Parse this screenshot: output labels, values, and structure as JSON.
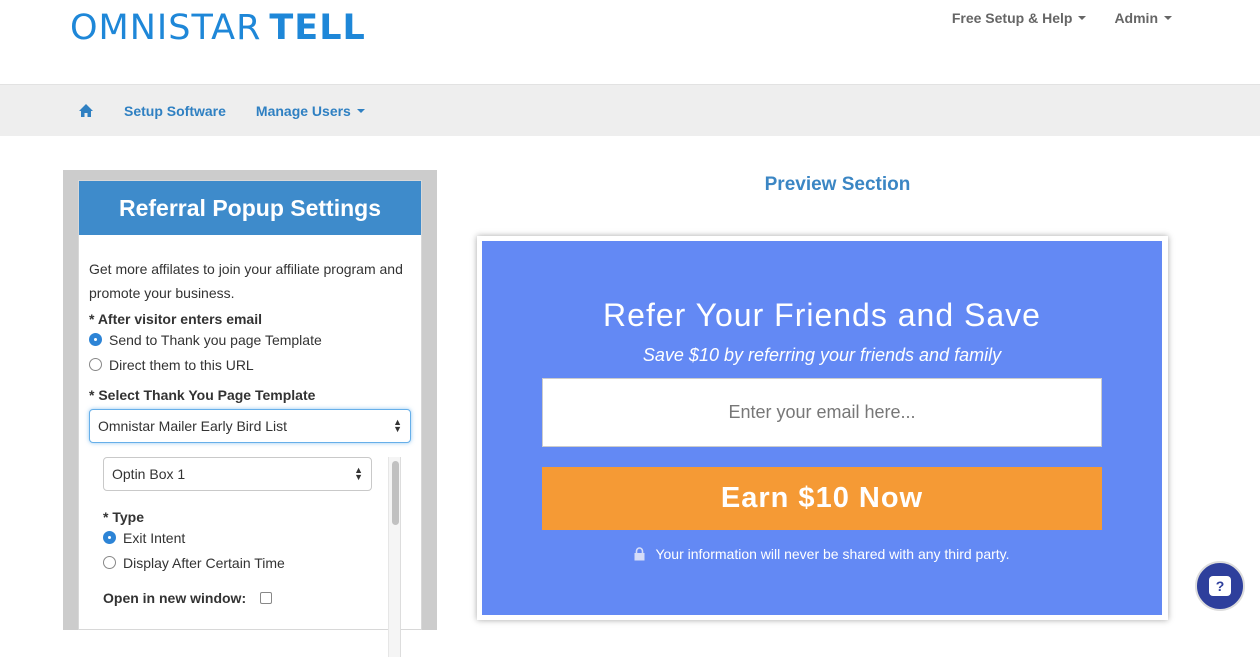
{
  "header": {
    "logo_thin": "OMNISTAR",
    "logo_bold": "TELL",
    "menu": [
      {
        "label": "Free Setup & Help"
      },
      {
        "label": "Admin"
      }
    ]
  },
  "nav": {
    "items": [
      {
        "label": "Setup Software"
      },
      {
        "label": "Manage Users"
      }
    ]
  },
  "settings": {
    "title": "Referral Popup Settings",
    "intro": "Get more affilates to join your affiliate program and promote your business.",
    "after_email_label": "* After visitor enters email",
    "after_email_options": [
      {
        "label": "Send to Thank you page Template",
        "checked": true
      },
      {
        "label": "Direct them to this URL",
        "checked": false
      }
    ],
    "template_label": "* Select Thank You Page Template",
    "template_value": "Omnistar Mailer Early Bird List",
    "optin_value": "Optin Box 1",
    "type_label": "* Type",
    "type_options": [
      {
        "label": "Exit Intent",
        "checked": true
      },
      {
        "label": "Display After Certain Time",
        "checked": false
      }
    ],
    "new_window_label": "Open in new window:"
  },
  "preview": {
    "section_title": "Preview Section",
    "headline": "Refer Your Friends and Save",
    "subheadline": "Save $10 by referring your friends and family",
    "email_placeholder": "Enter your email here...",
    "button_label": "Earn $10 Now",
    "privacy_text": "Your information will never be shared with any third party.",
    "background_color": "#6389f4",
    "button_color": "#f59a35"
  },
  "help": {
    "label": "?"
  }
}
